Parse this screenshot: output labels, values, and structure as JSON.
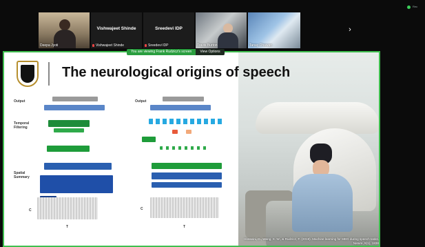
{
  "meeting": {
    "recording_label": "Rec"
  },
  "participants": [
    {
      "name": "Deepa Jyoti"
    },
    {
      "name": "Vishwajeet Shinde",
      "caption": "Vishwajeet Shinde"
    },
    {
      "name": "Sreedevi IDP",
      "caption": "Sreedevi IDP"
    },
    {
      "name": "Travis Burton"
    },
    {
      "name": "Tanay Dhawan"
    }
  ],
  "share_banner": {
    "message": "You are viewing Frank Rudzicz's screen",
    "options_label": "View Options"
  },
  "slide": {
    "title": "The neurological origins of speech",
    "citation": "Hosseini, D., Wang, X. W., & Rudzicz, F. (2019). Machine learning for MEG during speech tasks. Nature, 9(1), 1838"
  },
  "diagram": {
    "left": {
      "output": "Output",
      "temporal": "Temporal Filtering",
      "spatial": "Spatial Summary",
      "c": "C",
      "t": "T"
    },
    "right": {
      "output": "Output",
      "c": "C",
      "t": "T"
    }
  },
  "colors": {
    "share_border": "#3fbf4f",
    "banner": "#2a9e3f",
    "logo_gold": "#b68f2e"
  }
}
